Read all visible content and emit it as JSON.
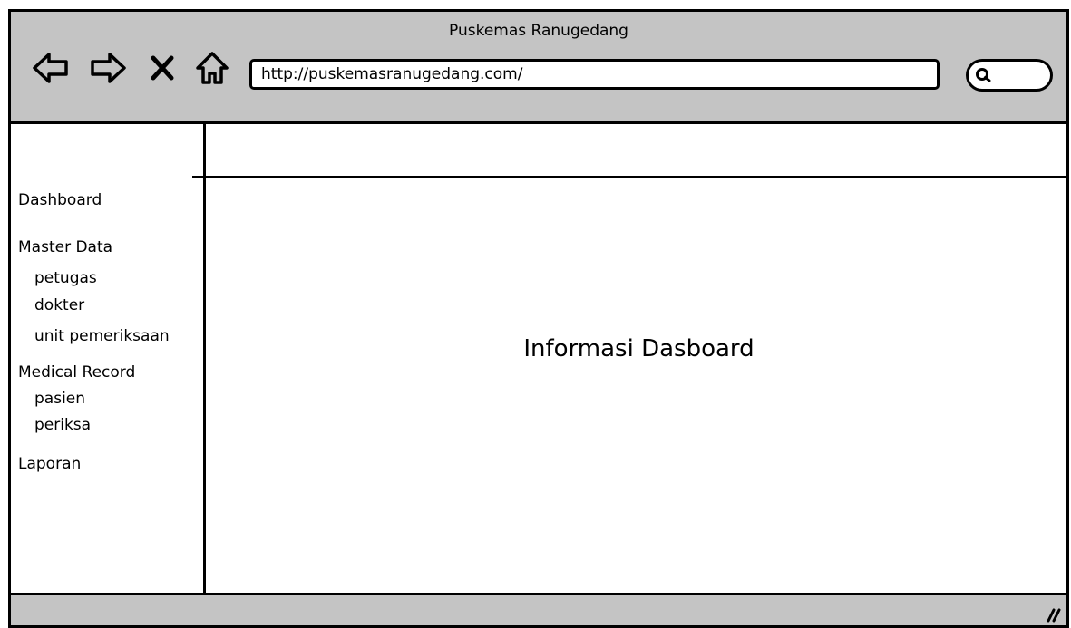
{
  "window": {
    "title": "Puskemas Ranugedang",
    "address_url": "http://puskemasranugedang.com/"
  },
  "toolbar": {
    "icons": [
      "back-arrow-icon",
      "forward-arrow-icon",
      "close-icon",
      "home-icon",
      "search-icon"
    ]
  },
  "sidebar": {
    "items": [
      {
        "label": "Dashboard"
      },
      {
        "label": "Master Data"
      },
      {
        "label": "petugas"
      },
      {
        "label": "dokter"
      },
      {
        "label": "unit pemeriksaan"
      },
      {
        "label": "Medical Record"
      },
      {
        "label": "pasien"
      },
      {
        "label": "periksa"
      },
      {
        "label": "Laporan"
      }
    ]
  },
  "main": {
    "title": "Informasi Dasboard"
  },
  "colors": {
    "chrome": "#c4c4c4",
    "border": "#000000",
    "background": "#ffffff"
  }
}
